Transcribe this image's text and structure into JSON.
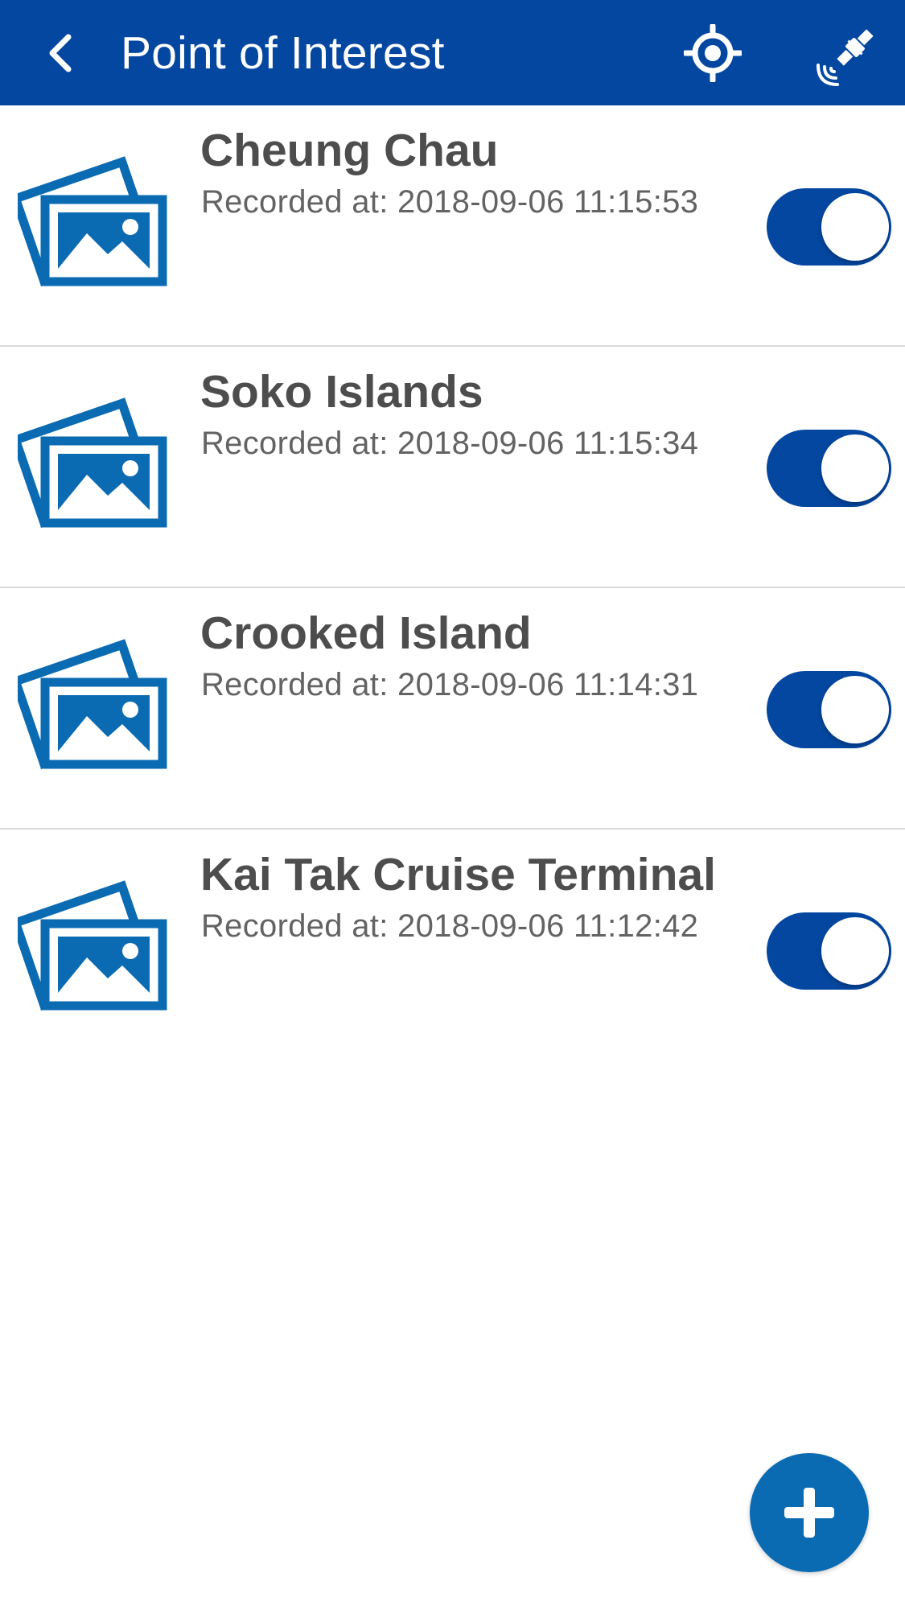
{
  "header": {
    "title": "Point of Interest",
    "back_icon": "chevron-left-icon",
    "locate_icon": "crosshair-icon",
    "satellite_icon": "satellite-icon",
    "background_color": "#0447a1"
  },
  "poi_list": {
    "items": [
      {
        "name": "Cheung Chau",
        "recorded": "Recorded at: 2018-09-06 11:15:53",
        "enabled": true,
        "icon": "image-gallery-icon"
      },
      {
        "name": "Soko Islands",
        "recorded": "Recorded at: 2018-09-06 11:15:34",
        "enabled": true,
        "icon": "image-gallery-icon"
      },
      {
        "name": "Crooked Island",
        "recorded": "Recorded at: 2018-09-06 11:14:31",
        "enabled": true,
        "icon": "image-gallery-icon"
      },
      {
        "name": "Kai Tak Cruise Terminal",
        "recorded": "Recorded at: 2018-09-06 11:12:42",
        "enabled": true,
        "icon": "image-gallery-icon"
      }
    ]
  },
  "fab": {
    "icon": "plus-icon",
    "color": "#0a6bb3"
  },
  "colors": {
    "accent": "#0447a1",
    "thumbnail": "#0a6bb3",
    "title_text": "#4d4d4d",
    "subtitle_text": "#636363"
  }
}
